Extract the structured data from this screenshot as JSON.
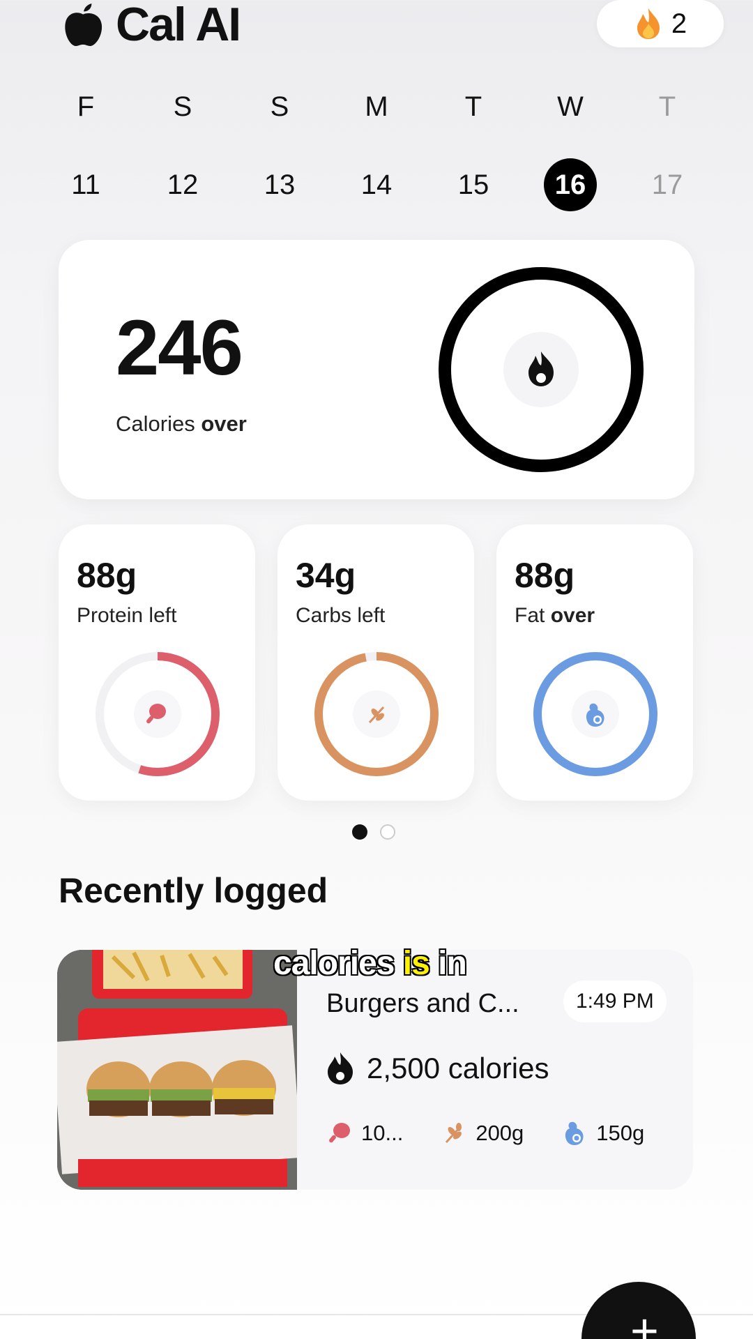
{
  "header": {
    "app_name": "Cal AI",
    "streak_count": "2"
  },
  "week": [
    {
      "letter": "F",
      "date": "11",
      "state": "normal"
    },
    {
      "letter": "S",
      "date": "12",
      "state": "normal"
    },
    {
      "letter": "S",
      "date": "13",
      "state": "normal"
    },
    {
      "letter": "M",
      "date": "14",
      "state": "normal"
    },
    {
      "letter": "T",
      "date": "15",
      "state": "normal"
    },
    {
      "letter": "W",
      "date": "16",
      "state": "active"
    },
    {
      "letter": "T",
      "date": "17",
      "state": "future"
    }
  ],
  "calories": {
    "value": "246",
    "label": "Calories",
    "status": "over"
  },
  "macros": [
    {
      "value": "88g",
      "label": "Protein",
      "status": "left",
      "color": "#dd5f6c",
      "icon": "drumstick-icon"
    },
    {
      "value": "34g",
      "label": "Carbs",
      "status": "left",
      "color": "#d89361",
      "icon": "wheat-icon"
    },
    {
      "value": "88g",
      "label": "Fat",
      "status": "over",
      "color": "#6b9be0",
      "icon": "avocado-icon"
    }
  ],
  "pager": {
    "pages": 2,
    "current": 1
  },
  "recently_logged": {
    "title": "Recently logged",
    "items": [
      {
        "name": "Burgers and C...",
        "time": "1:49 PM",
        "calories": "2,500 calories",
        "protein": "10...",
        "carbs": "200g",
        "fat": "150g"
      }
    ]
  },
  "caption": {
    "part1": "calories ",
    "highlight": "is",
    "part2": " in"
  },
  "fab": {
    "label": "+"
  }
}
